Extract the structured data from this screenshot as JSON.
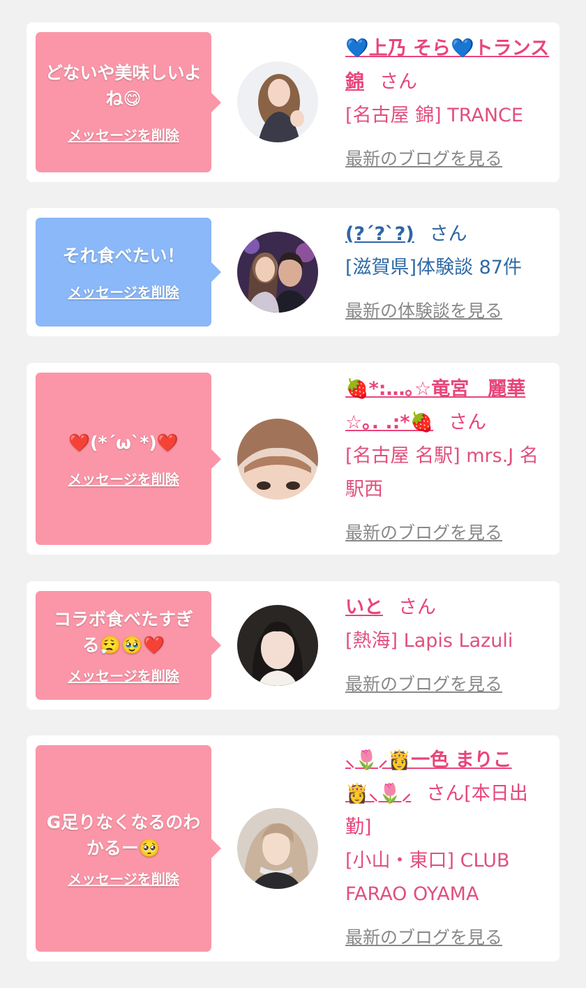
{
  "colors": {
    "pink_bubble": "#fb96a8",
    "blue_bubble": "#8ab8f8",
    "pink_text": "#e8457a",
    "blue_text": "#2f65a6"
  },
  "delete_label": "メッセージを削除",
  "san_suffix": "さん",
  "cards": [
    {
      "message": "どないや美味しいよね😋",
      "name": "💙上乃 そら💙トランス 錦",
      "san": "さん",
      "shop": "[名古屋 錦] TRANCE",
      "link": "最新のブログを見る"
    },
    {
      "message": "それ食べたい！",
      "name": "(?´?`?)",
      "san": "さん",
      "shop": "[滋賀県]体験談 87件",
      "link": "最新の体験談を見る"
    },
    {
      "message": "❤️(*´ω`*)❤️",
      "name": "🍓*:…｡☆竜宮　麗華☆｡. .:*🍓",
      "san": "さん",
      "shop": "[名古屋 名駅] mrs.J 名駅西",
      "link": "最新のブログを見る"
    },
    {
      "message": "コラボ食べたすぎる😮‍💨🥹❤️",
      "name": "いと",
      "san": "さん",
      "shop": "[熱海] Lapis Lazuli",
      "link": "最新のブログを見る"
    },
    {
      "message": "G足りなくなるのわかるー🥺",
      "name": "⸜🌷⸝👸一色 まりこ👸⸜🌷⸝",
      "san": "さん[本日出勤]",
      "shop": "[小山・東口] CLUB FARAO OYAMA",
      "link": "最新のブログを見る"
    }
  ]
}
